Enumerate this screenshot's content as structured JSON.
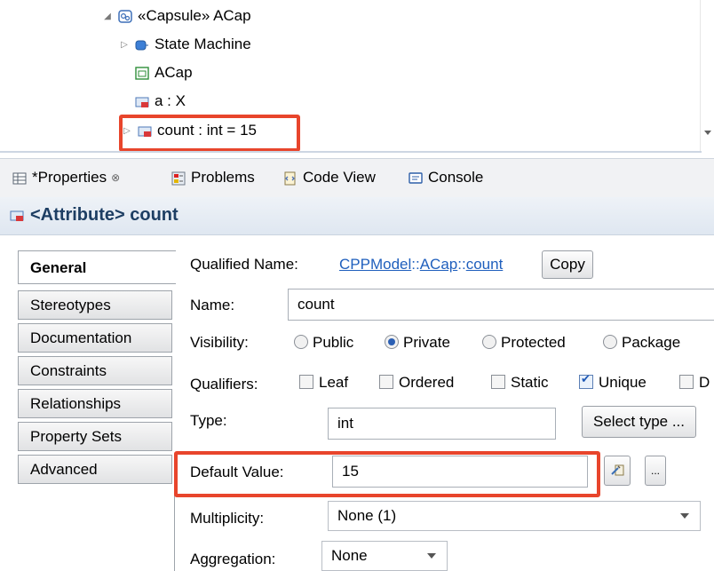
{
  "tree": {
    "capsule_label": "«Capsule» ACap",
    "state_machine_label": "State Machine",
    "acap_label": "ACap",
    "attr_a_label": "a : X",
    "attr_count_label": "count : int = 15"
  },
  "tabs": [
    {
      "label": "*Properties",
      "close": "⊗"
    },
    {
      "label": "Problems"
    },
    {
      "label": "Code View"
    },
    {
      "label": "Console"
    }
  ],
  "header": {
    "title": "<Attribute> count"
  },
  "side_tabs": [
    "General",
    "Stereotypes",
    "Documentation",
    "Constraints",
    "Relationships",
    "Property Sets",
    "Advanced"
  ],
  "form": {
    "qualified_name_label": "Qualified Name:",
    "qn_parts": [
      "CPPModel",
      "::",
      "ACap",
      "::",
      "count"
    ],
    "copy_label": "Copy",
    "name_label": "Name:",
    "name_value": "count",
    "visibility_label": "Visibility:",
    "visibility_options": [
      "Public",
      "Private",
      "Protected",
      "Package"
    ],
    "visibility_selected": "Private",
    "qualifiers_label": "Qualifiers:",
    "qualifier_options": [
      "Leaf",
      "Ordered",
      "Static",
      "Unique",
      "D"
    ],
    "qualifier_checked": [
      "Unique"
    ],
    "type_label": "Type:",
    "type_value": "int",
    "select_type_label": "Select type ...",
    "default_value_label": "Default Value:",
    "default_value": "15",
    "ellipsis_label": "...",
    "multiplicity_label": "Multiplicity:",
    "multiplicity_value": "None (1)",
    "aggregation_label": "Aggregation:",
    "aggregation_value": "None"
  },
  "colors": {
    "highlight": "#e8452c",
    "link": "#1f5fbd",
    "header_text": "#1d3e63"
  }
}
